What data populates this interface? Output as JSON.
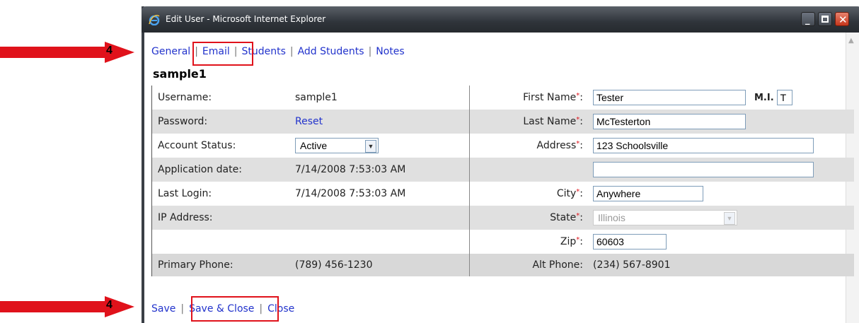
{
  "window": {
    "title": "Edit User - Microsoft Internet Explorer"
  },
  "callouts": [
    {
      "number": "4"
    },
    {
      "number": "4"
    }
  ],
  "tabs": [
    {
      "label": "General"
    },
    {
      "label": "Email"
    },
    {
      "label": "Students"
    },
    {
      "label": "Add Students"
    },
    {
      "label": "Notes"
    }
  ],
  "tab_separator": "|",
  "user": {
    "heading": "sample1"
  },
  "fields": {
    "username": {
      "label": "Username:",
      "value": "sample1"
    },
    "password": {
      "label": "Password:",
      "link": "Reset"
    },
    "account_status": {
      "label": "Account Status:",
      "value": "Active"
    },
    "application_date": {
      "label": "Application date:",
      "value": "7/14/2008 7:53:03 AM"
    },
    "last_login": {
      "label": "Last Login:",
      "value": "7/14/2008 7:53:03 AM"
    },
    "ip_address": {
      "label": "IP Address:",
      "value": ""
    },
    "primary_phone": {
      "label": "Primary Phone:",
      "value": "(789) 456-1230"
    },
    "first_name": {
      "label": "First Name",
      "value": "Tester"
    },
    "mi": {
      "label": "M.I.",
      "value": "T"
    },
    "last_name": {
      "label": "Last Name",
      "value": "McTesterton"
    },
    "address": {
      "label": "Address",
      "value": "123 Schoolsville",
      "value2": ""
    },
    "city": {
      "label": "City",
      "value": "Anywhere"
    },
    "state": {
      "label": "State",
      "value": "Illinois"
    },
    "zip": {
      "label": "Zip",
      "value": "60603"
    },
    "alt_phone": {
      "label": "Alt Phone:",
      "value": "(234) 567-8901"
    }
  },
  "required_mark": "*",
  "colon": ":",
  "actions": {
    "save": "Save",
    "save_close": "Save & Close",
    "close": "Close"
  },
  "colors": {
    "link": "#2233cc",
    "highlight": "#e0121b",
    "arrow": "#e0121b"
  }
}
